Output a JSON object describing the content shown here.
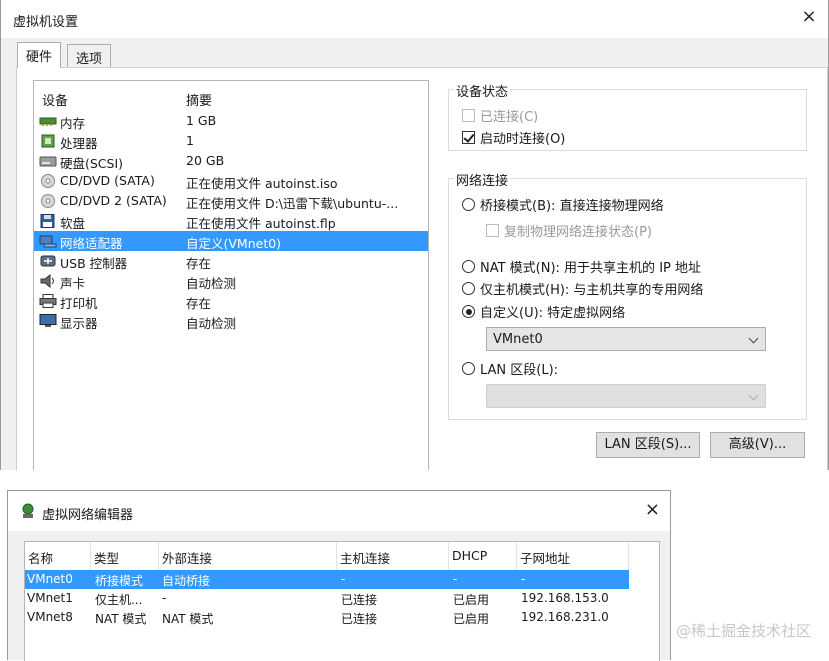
{
  "vm_settings": {
    "title": "虚拟机设置",
    "close": "×",
    "tabs": [
      {
        "label": "硬件",
        "active": true
      },
      {
        "label": "选项",
        "active": false
      }
    ],
    "device_list": {
      "headers": {
        "device": "设备",
        "summary": "摘要"
      },
      "rows": [
        {
          "name": "内存",
          "summary": "1 GB",
          "icon": "memory-icon"
        },
        {
          "name": "处理器",
          "summary": "1",
          "icon": "processor-icon"
        },
        {
          "name": "硬盘(SCSI)",
          "summary": "20 GB",
          "icon": "hard-disk-icon"
        },
        {
          "name": "CD/DVD (SATA)",
          "summary": "正在使用文件 autoinst.iso",
          "icon": "cd-dvd-icon"
        },
        {
          "name": "CD/DVD 2 (SATA)",
          "summary": "正在使用文件 D:\\迅雷下载\\ubuntu-...",
          "icon": "cd-dvd-icon"
        },
        {
          "name": "软盘",
          "summary": "正在使用文件 autoinst.flp",
          "icon": "floppy-icon"
        },
        {
          "name": "网络适配器",
          "summary": "自定义(VMnet0)",
          "icon": "network-adapter-icon",
          "selected": true
        },
        {
          "name": "USB 控制器",
          "summary": "存在",
          "icon": "usb-icon"
        },
        {
          "name": "声卡",
          "summary": "自动检测",
          "icon": "sound-card-icon"
        },
        {
          "name": "打印机",
          "summary": "存在",
          "icon": "printer-icon"
        },
        {
          "name": "显示器",
          "summary": "自动检测",
          "icon": "display-icon"
        }
      ]
    },
    "device_status": {
      "label": "设备状态",
      "connected": {
        "label": "已连接(C)",
        "checked": false,
        "enabled": false
      },
      "connect_at_power_on": {
        "label": "启动时连接(O)",
        "checked": true,
        "enabled": true
      }
    },
    "network_connection": {
      "label": "网络连接",
      "bridged": {
        "label": "桥接模式(B): 直接连接物理网络",
        "selected": false
      },
      "replicate": {
        "label": "复制物理网络连接状态(P)",
        "checked": false,
        "enabled": false
      },
      "nat": {
        "label": "NAT 模式(N): 用于共享主机的 IP 地址",
        "selected": false
      },
      "host_only": {
        "label": "仅主机模式(H): 与主机共享的专用网络",
        "selected": false
      },
      "custom": {
        "label": "自定义(U): 特定虚拟网络",
        "selected": true
      },
      "custom_select_value": "VMnet0",
      "lan_segment": {
        "label": "LAN 区段(L):",
        "selected": false
      },
      "lan_select_value": ""
    },
    "buttons": {
      "lan_segments": "LAN 区段(S)...",
      "advanced": "高级(V)..."
    }
  },
  "network_editor": {
    "title": "虚拟网络编辑器",
    "close": "×",
    "headers": [
      "名称",
      "类型",
      "外部连接",
      "主机连接",
      "DHCP",
      "子网地址"
    ],
    "rows": [
      {
        "name": "VMnet0",
        "type": "桥接模式",
        "external": "自动桥接",
        "host": "-",
        "dhcp": "-",
        "subnet": "-",
        "selected": true
      },
      {
        "name": "VMnet1",
        "type": "仅主机...",
        "external": "-",
        "host": "已连接",
        "dhcp": "已启用",
        "subnet": "192.168.153.0",
        "selected": false
      },
      {
        "name": "VMnet8",
        "type": "NAT 模式",
        "external": "NAT 模式",
        "host": "已连接",
        "dhcp": "已启用",
        "subnet": "192.168.231.0",
        "selected": false
      }
    ]
  },
  "watermark": "@稀土掘金技术社区",
  "colors": {
    "selection": "#3399ff",
    "window_bg": "#f0f0f0"
  }
}
